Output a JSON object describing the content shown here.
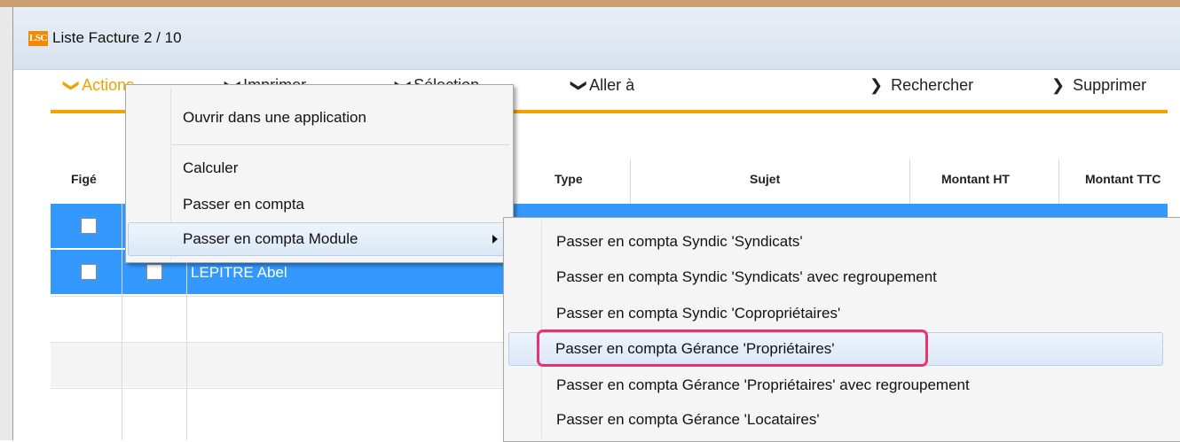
{
  "window": {
    "logo_text": "LSC",
    "title": "Liste  Facture 2 / 10"
  },
  "toolbar": {
    "actions_label": "Actions",
    "imprimer_label": "Imprimer",
    "selection_label": "Sélection",
    "aller_label": "Aller à",
    "rechercher_label": "Rechercher",
    "supprimer_label": "Supprimer",
    "chevron_down": "❯",
    "chevron_right": "❯"
  },
  "grid": {
    "headers": {
      "fige": "Figé",
      "type": "Type",
      "sujet": "Sujet",
      "montant_ht": "Montant HT",
      "montant_ttc": "Montant TTC"
    },
    "rows": [
      {
        "name": ""
      },
      {
        "name": "LEPITRE Abel"
      }
    ]
  },
  "context_menu": {
    "items": [
      "Ouvrir dans une application",
      "Calculer",
      "Passer en compta",
      "Passer en compta Module"
    ]
  },
  "submenu": {
    "items": [
      "Passer en compta Syndic 'Syndicats'",
      "Passer en compta Syndic 'Syndicats' avec regroupement",
      "Passer en compta Syndic 'Copropriétaires'",
      "Passer en compta Gérance 'Propriétaires'",
      "Passer en compta Gérance 'Propriétaires' avec regroupement",
      "Passer en compta Gérance 'Locataires'"
    ]
  },
  "colors": {
    "accent_orange": "#f5a100",
    "selection_blue": "#3399ff",
    "highlight_pink": "#e8336f"
  }
}
